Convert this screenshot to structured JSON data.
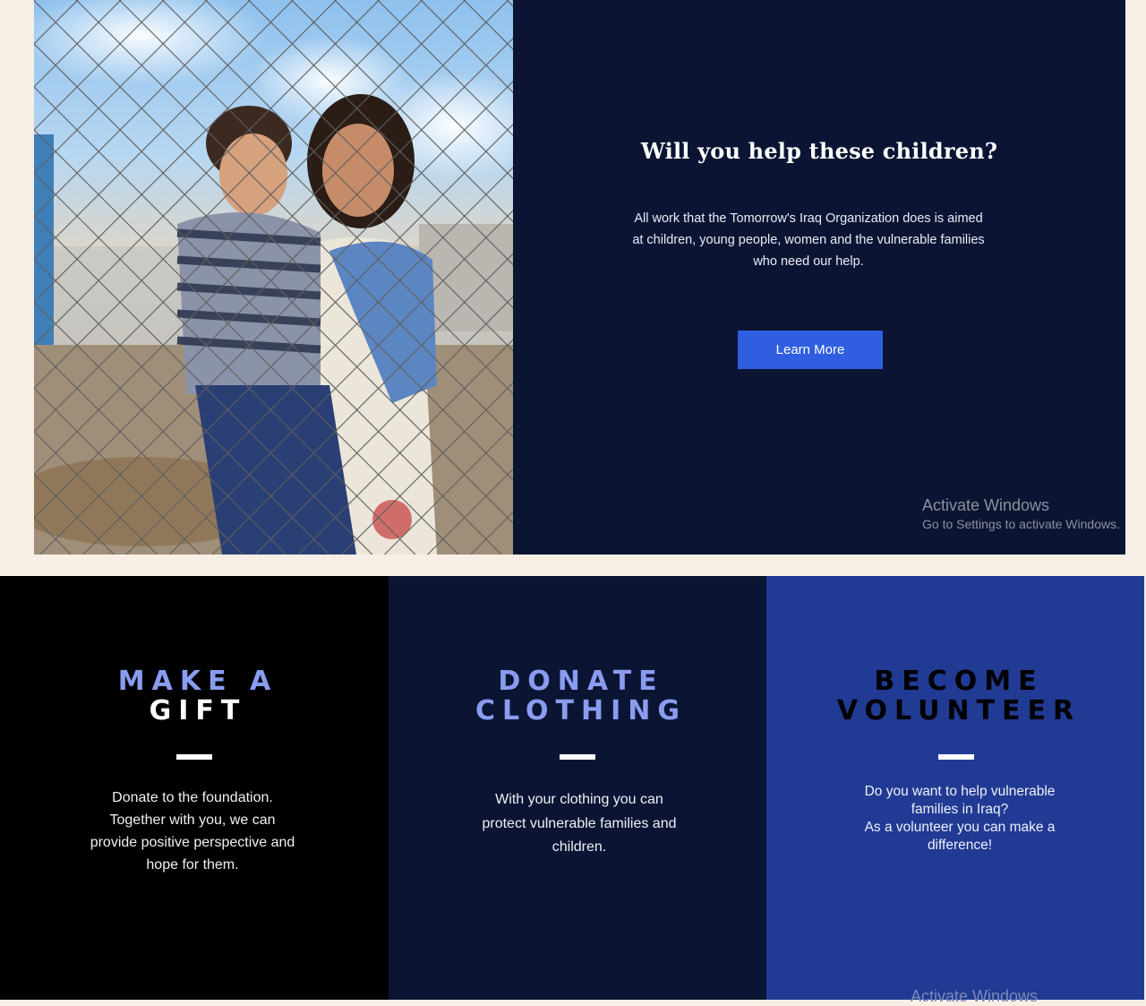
{
  "hero": {
    "image_alt": "Two children standing behind a chain-link fence",
    "title": "Will you help these children?",
    "body": "All work that the Tomorrow's Iraq Organization does is aimed at children, young people, women and the vulnerable families who need our help.",
    "button_label": "Learn More"
  },
  "cards": {
    "gift": {
      "title_line1": "MAKE A",
      "title_line2": "GIFT",
      "text": "Donate to the foundation. Together with you, we can provide positive perspective and hope for them."
    },
    "clothing": {
      "title_line1": "DONATE",
      "title_line2": "CLOTHING",
      "text": "With your clothing you can protect vulnerable families and children."
    },
    "volunteer": {
      "title_line1": "BECOME",
      "title_line2": "VOLUNTEER",
      "text_line1": "Do you want to help vulnerable families in Iraq?",
      "text_line2": "As a volunteer you can make a difference!"
    }
  },
  "watermark": {
    "title": "Activate Windows",
    "subtitle": "Go to Settings to activate Windows."
  },
  "colors": {
    "page_bg": "#f7efe6",
    "navy": "#0b1533",
    "royal": "#213a94",
    "button": "#2f5fe0",
    "title_lavender": "#8a9cf0",
    "black": "#000000"
  }
}
